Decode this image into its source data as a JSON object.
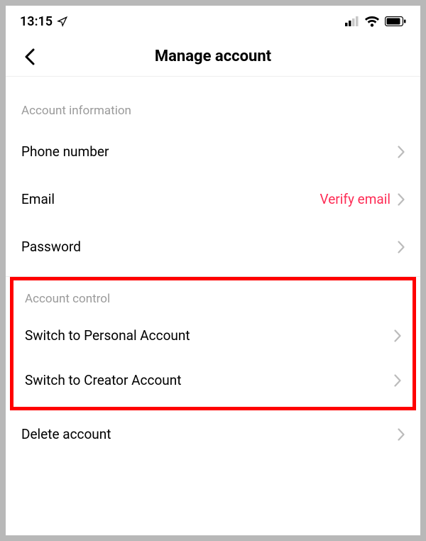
{
  "status_bar": {
    "time": "13:15"
  },
  "nav": {
    "title": "Manage account"
  },
  "sections": {
    "account_information": {
      "header": "Account information",
      "phone": "Phone number",
      "email": "Email",
      "email_value": "Verify email",
      "password": "Password"
    },
    "account_control": {
      "header": "Account control",
      "switch_personal": "Switch to Personal Account",
      "switch_creator": "Switch to Creator Account",
      "delete": "Delete account"
    }
  }
}
